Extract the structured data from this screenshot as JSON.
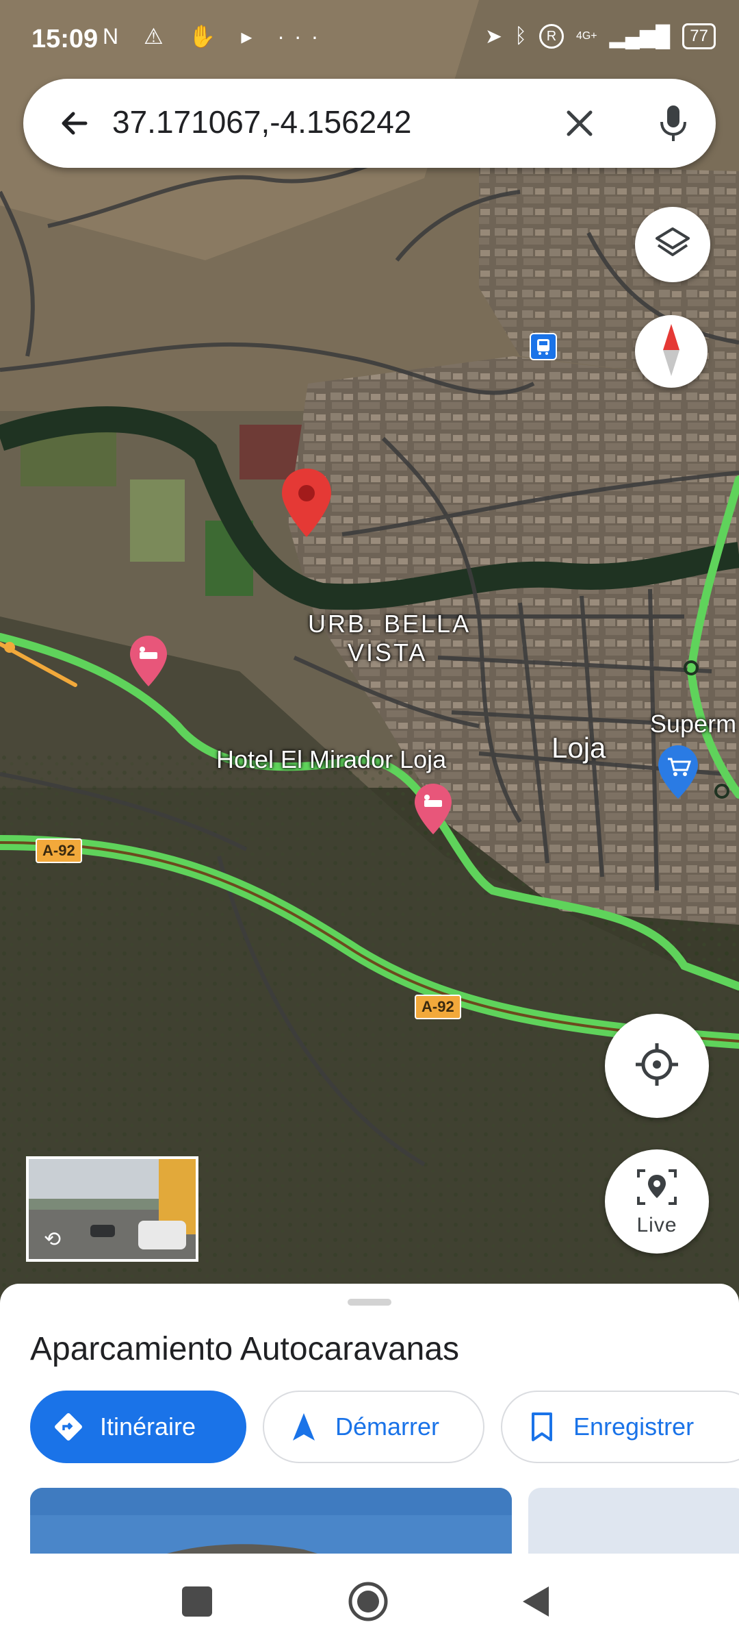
{
  "status_bar": {
    "time": "15:09",
    "left_icons": "N ⚠ ✋ ▸ ···",
    "network": "4G+",
    "battery": "77"
  },
  "search": {
    "query": "37.171067,-4.156242"
  },
  "map": {
    "labels": {
      "urb_line1": "URB. BELLA",
      "urb_line2": "VISTA",
      "hotel": "Hotel El Mirador Loja",
      "city": "Loja",
      "supermarket": "Superm"
    },
    "road_shields": [
      "A-92",
      "A-92"
    ],
    "colors": {
      "traffic_green": "#5fd35b",
      "pin_red": "#e53935",
      "hotel_pin": "#e8567a",
      "shop_pin": "#2a7be4"
    }
  },
  "controls": {
    "live_label": "Live"
  },
  "sheet": {
    "title": "Aparcamiento Autocaravanas",
    "buttons": {
      "directions": "Itinéraire",
      "start": "Démarrer",
      "save": "Enregistrer"
    }
  }
}
